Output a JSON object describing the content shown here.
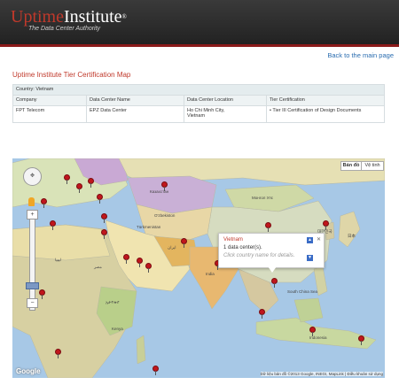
{
  "header": {
    "logo_part1": "Uptime",
    "logo_part2": "Institute",
    "trademark": "®",
    "tagline": "The Data Center Authority"
  },
  "back_link": "Back to the main page",
  "page_title": "Uptime Institute Tier Certification Map",
  "table": {
    "country_row": "Country: Vietnam",
    "headers": [
      "Company",
      "Data Center Name",
      "Data Center Location",
      "Tier Certification"
    ],
    "row": {
      "company": "FPT Telecom",
      "dc_name": "EPZ Data Center",
      "location_line1": "Ho Chi Minh City,",
      "location_line2": "Vietnam",
      "certification": "Tier III Certification of Design Documents"
    }
  },
  "map": {
    "map_button": "Bản đồ",
    "satellite_button": "Vệ tinh",
    "zoom_in": "+",
    "zoom_out": "−",
    "popup": {
      "title": "Vietnam",
      "count": "1 data center(s).",
      "hint": "Click country name for details."
    },
    "country_labels": {
      "kazakhstan": "Казахстан",
      "mongolia": "Монгол Улс",
      "china": "中国",
      "uzbekistan": "O'zbekiston",
      "turkmenistan": "Türkmenistan",
      "iran": "ایران",
      "libya": "ليبيا",
      "egypt": "مصر",
      "kenya": "Kenya",
      "japan": "日本",
      "south_korea": "대한민국",
      "india": "India",
      "indonesia": "Indonesia",
      "ethiopia": "ኢትዮጵያ",
      "south_china_sea": "South China Sea"
    },
    "google_logo": "Google",
    "copyright": "Dữ liệu bản đồ ©2013 Google, INEGI, MapLink | Điều khoản sử dụng"
  },
  "colors": {
    "brand_red": "#c0392b",
    "header_bg": "#2b2b2b",
    "link_blue": "#2a6db0",
    "pin_red": "#c0161c"
  }
}
